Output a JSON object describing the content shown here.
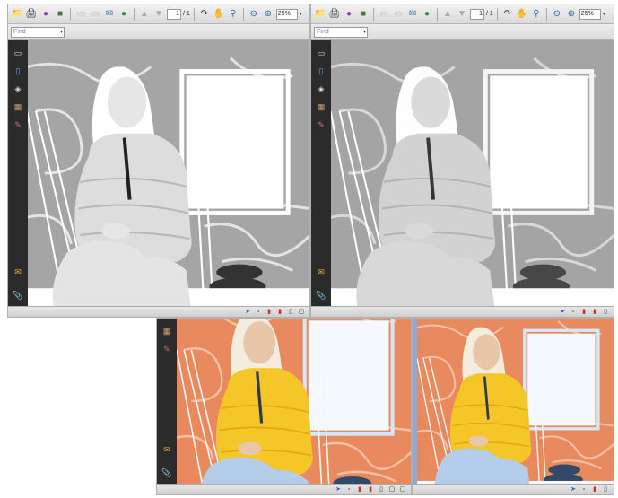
{
  "toolbar": {
    "page_current": "1",
    "page_total": "/ 1",
    "zoom": "25%"
  },
  "find": {
    "placeholder": "Find"
  },
  "colors": {
    "window_bg": "#d8d8d8",
    "left_panel": "#2b2b2b",
    "jacket_gray": "#e8e8e8",
    "jacket_yellow": "#f2c21a",
    "wall_orange": "#e07a4a"
  },
  "windows": [
    {
      "id": "top-left",
      "variant": "grayscale-high-contrast"
    },
    {
      "id": "top-right",
      "variant": "grayscale"
    },
    {
      "id": "bottom-left",
      "variant": "color-inverted"
    },
    {
      "id": "bottom-right",
      "variant": "color-inverted-light"
    }
  ]
}
